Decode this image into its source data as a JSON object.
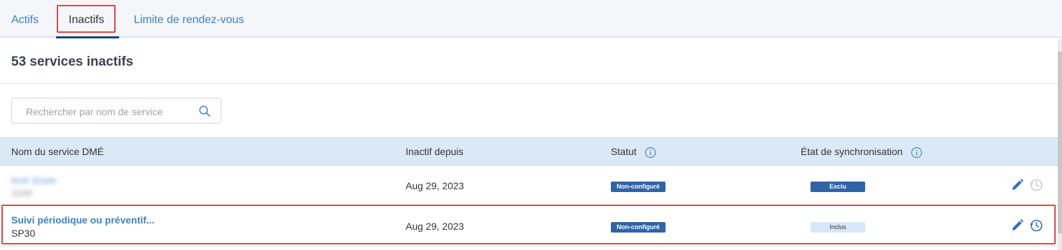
{
  "tabs": [
    {
      "label": "Actifs"
    },
    {
      "label": "Inactifs"
    },
    {
      "label": "Limite de rendez-vous"
    }
  ],
  "page": {
    "title": "53 services inactifs"
  },
  "search": {
    "placeholder": "Rechercher par nom de service",
    "value": ""
  },
  "table": {
    "headers": {
      "name": "Nom du service DMÉ",
      "inactive_since": "Inactif depuis",
      "status": "Statut",
      "sync": "État de synchronisation"
    },
    "rows": [
      {
        "name": "test 11am",
        "code": "1100",
        "inactive_since": "Aug 29, 2023",
        "status": "Non-configuré",
        "sync": "Exclu"
      },
      {
        "name": "Suivi périodique ou préventif...",
        "code": "SP30",
        "inactive_since": "Aug 29, 2023",
        "status": "Non-configuré",
        "sync": "Inclus"
      }
    ]
  },
  "colors": {
    "accent": "#3b82c4",
    "header_bg": "#dbe9f6",
    "badge_dark": "#2e64a8",
    "badge_light": "#d5e7f8",
    "highlight": "#e0454b"
  },
  "icons": {
    "search": "search-icon",
    "info": "info-icon",
    "edit": "pencil-icon",
    "history": "history-icon"
  }
}
